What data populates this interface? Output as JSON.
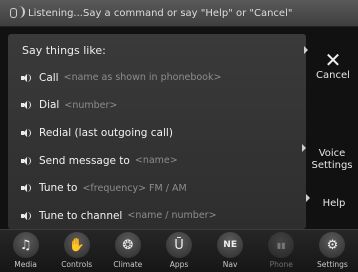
{
  "listening": {
    "text": "Listening...Say a command or say \"Help\" or \"Cancel\""
  },
  "hint_title": "Say things like:",
  "commands": [
    {
      "label": "Call",
      "param": "<name as shown in phonebook>"
    },
    {
      "label": "Dial",
      "param": "<number>"
    },
    {
      "label": "Redial (last outgoing call)",
      "param": ""
    },
    {
      "label": "Send message to",
      "param": "<name>"
    },
    {
      "label": "Tune to",
      "param": "<frequency> FM / AM"
    },
    {
      "label": "Tune to channel",
      "param": "<name / number>"
    }
  ],
  "side_buttons": {
    "cancel": "Cancel",
    "cancel_glyph": "✕",
    "voice_line1": "Voice",
    "voice_line2": "Settings",
    "help": "Help"
  },
  "nav": [
    {
      "label": "Media",
      "glyph": "♫",
      "icon": "music-note-icon"
    },
    {
      "label": "Controls",
      "glyph": "✋",
      "icon": "hand-icon"
    },
    {
      "label": "Climate",
      "glyph": "❂",
      "icon": "climate-icon"
    },
    {
      "label": "Apps",
      "glyph": "Ū",
      "icon": "apps-icon"
    },
    {
      "label": "Nav",
      "glyph": "NE",
      "icon": "compass-icon"
    },
    {
      "label": "Phone",
      "glyph": "▮▮",
      "icon": "phone-signal-icon"
    },
    {
      "label": "Settings",
      "glyph": "⚙",
      "icon": "gear-icon"
    }
  ]
}
